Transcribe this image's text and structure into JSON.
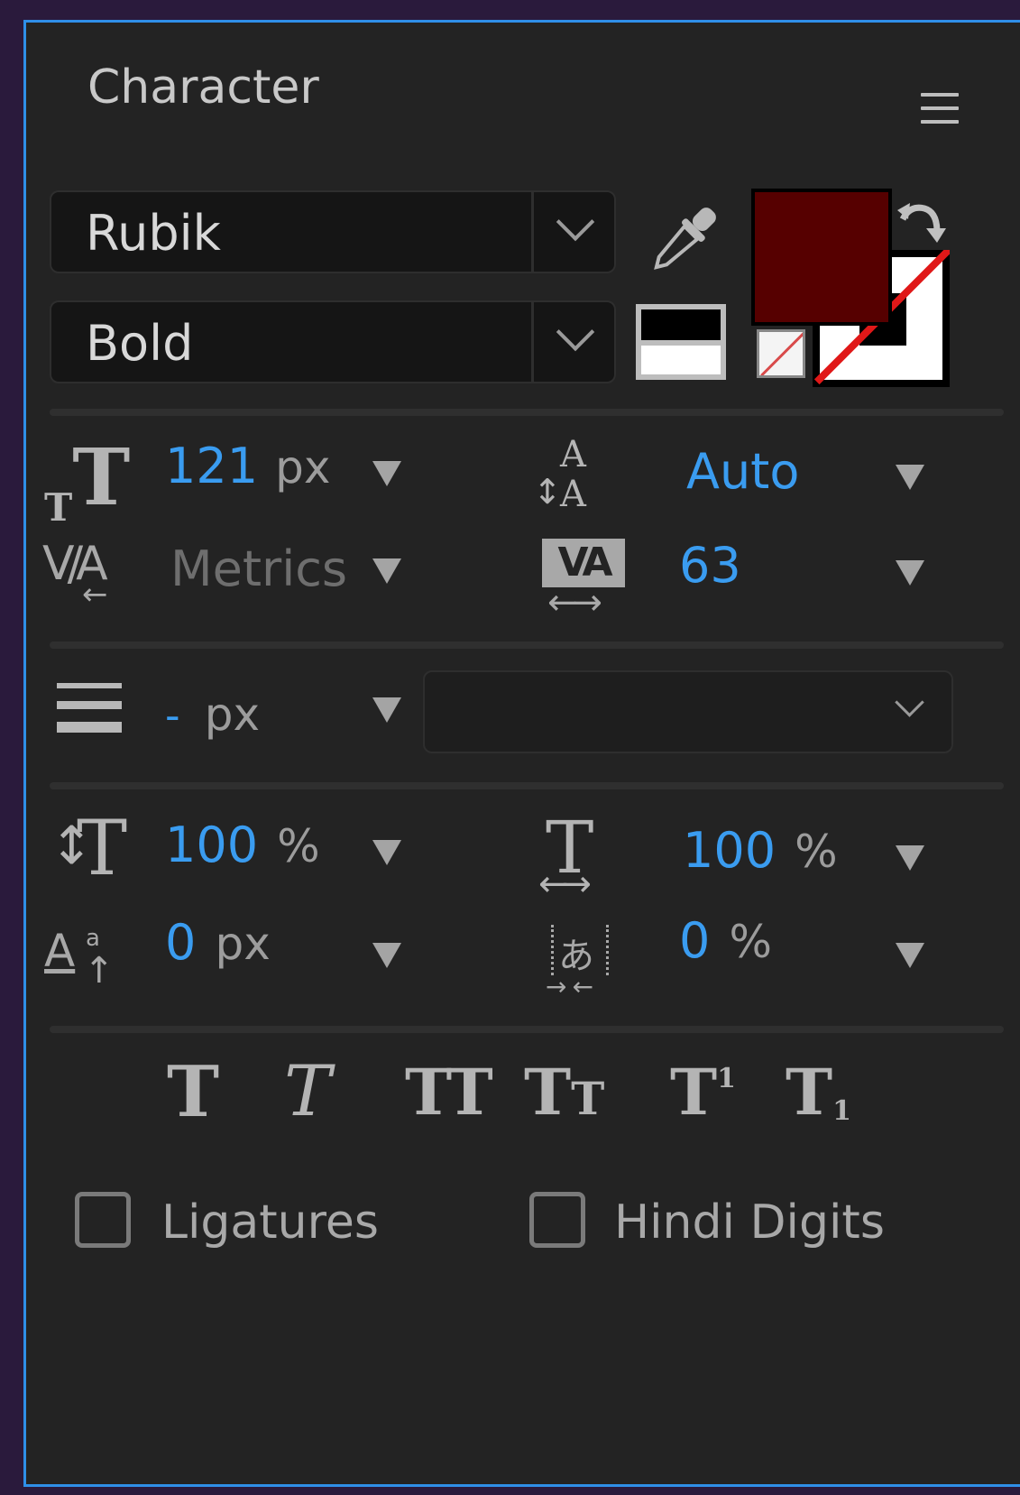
{
  "panel": {
    "title": "Character"
  },
  "font": {
    "family": "Rubik",
    "style": "Bold"
  },
  "colors": {
    "fill": "#560000",
    "stroke": "none",
    "accent": "#2f8fe8"
  },
  "size": {
    "value": "121",
    "unit": "px"
  },
  "leading": {
    "value": "Auto"
  },
  "kerning": {
    "value": "Metrics"
  },
  "tracking": {
    "value": "63"
  },
  "stroke_width": {
    "value": "-",
    "unit": "px"
  },
  "vertical_scale": {
    "value": "100",
    "unit": "%"
  },
  "horizontal_scale": {
    "value": "100",
    "unit": "%"
  },
  "baseline_shift": {
    "value": "0",
    "unit": "px"
  },
  "tsume": {
    "value": "0",
    "unit": "%"
  },
  "styles": {
    "faux_bold": "T",
    "faux_italic": "T",
    "all_caps": "TT",
    "small_caps": "TT",
    "superscript": "T¹",
    "subscript": "T₁"
  },
  "options": {
    "ligatures": "Ligatures",
    "hindi_digits": "Hindi Digits"
  }
}
